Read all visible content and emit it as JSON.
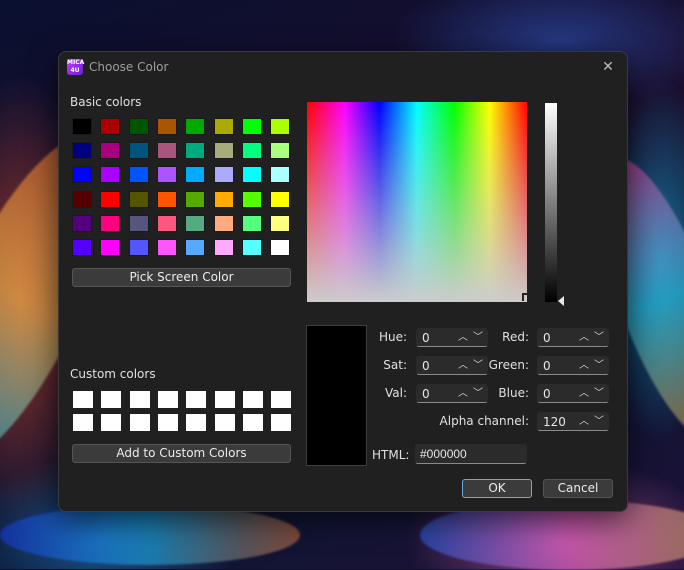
{
  "window": {
    "title": "Choose Color",
    "app_icon_text": "MICA 4U"
  },
  "colors": {
    "primary_border": "#6aa9e8",
    "dialog_bg": "#202020"
  },
  "basic_colors_label": "Basic colors",
  "basic_colors": [
    [
      "#000000",
      "#aa0000",
      "#005500",
      "#aa5500",
      "#00aa00",
      "#aaaa00",
      "#00ff00",
      "#aaff00"
    ],
    [
      "#00007f",
      "#aa007f",
      "#00557f",
      "#aa557f",
      "#00aa7f",
      "#aaaa7f",
      "#00ff7f",
      "#aaff7f"
    ],
    [
      "#0000ff",
      "#aa00ff",
      "#0055ff",
      "#aa55ff",
      "#00aaff",
      "#aaaaff",
      "#00ffff",
      "#aaffff"
    ],
    [
      "#550000",
      "#ff0000",
      "#555500",
      "#ff5500",
      "#55aa00",
      "#ffaa00",
      "#55ff00",
      "#ffff00"
    ],
    [
      "#55007f",
      "#ff007f",
      "#55557f",
      "#ff557f",
      "#55aa7f",
      "#ffaa7f",
      "#55ff7f",
      "#ffff7f"
    ],
    [
      "#5500ff",
      "#ff00ff",
      "#5555ff",
      "#ff55ff",
      "#55aaff",
      "#ffaaff",
      "#55ffff",
      "#ffffff"
    ]
  ],
  "pick_screen_label": "Pick Screen Color",
  "custom_colors_label": "Custom colors",
  "add_custom_label": "Add to Custom Colors",
  "fields": {
    "hue": {
      "label": "Hue:",
      "value": "0"
    },
    "sat": {
      "label": "Sat:",
      "value": "0"
    },
    "val": {
      "label": "Val:",
      "value": "0"
    },
    "red": {
      "label": "Red:",
      "value": "0"
    },
    "green": {
      "label": "Green:",
      "value": "0"
    },
    "blue": {
      "label": "Blue:",
      "value": "0"
    },
    "alpha": {
      "label": "Alpha channel:",
      "value": "120"
    }
  },
  "html_field": {
    "label": "HTML:",
    "value": "#000000"
  },
  "buttons": {
    "ok": "OK",
    "cancel": "Cancel"
  },
  "icons": {
    "close": "close-icon",
    "spin_up": "chevron-up-icon",
    "spin_down": "chevron-down-icon"
  }
}
